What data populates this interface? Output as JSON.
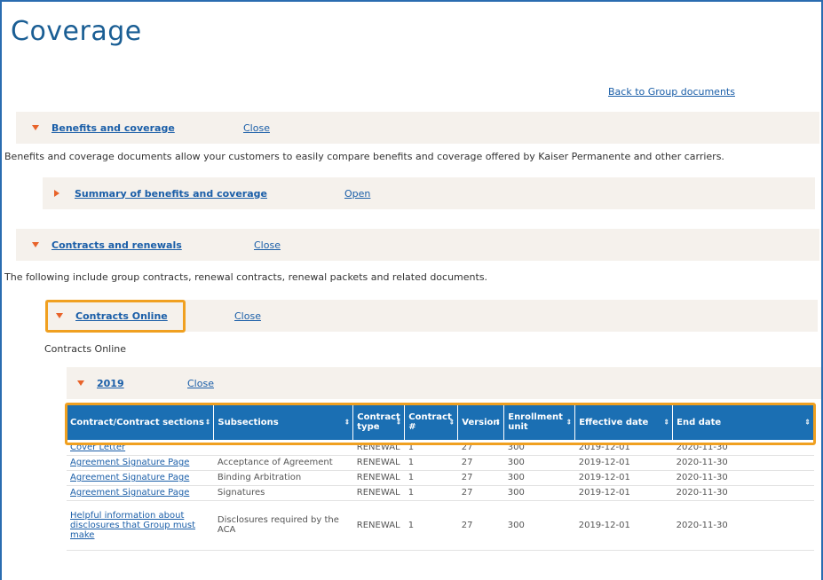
{
  "page": {
    "title": "Coverage",
    "back_link": "Back to Group documents"
  },
  "sections": {
    "benefits": {
      "title": "Benefits and coverage",
      "toggle": "Close",
      "description": "Benefits and coverage documents allow your customers to easily compare benefits and coverage offered by Kaiser Permanente and other carriers.",
      "summary": {
        "title": "Summary of benefits and coverage",
        "toggle": "Open"
      }
    },
    "contracts": {
      "title": "Contracts and renewals",
      "toggle": "Close",
      "description": "The following include group contracts, renewal contracts, renewal packets and related documents.",
      "online": {
        "title": "Contracts Online",
        "toggle": "Close",
        "label": "Contracts Online",
        "year": {
          "title": "2019",
          "toggle": "Close"
        }
      }
    }
  },
  "table": {
    "sort_icon": "sort-arrows-icon",
    "columns": [
      "Contract/Contract sections",
      "Subsections",
      "Contract type",
      "Contract #",
      "Version",
      "Enrollment unit",
      "Effective date",
      "End date"
    ],
    "rows": [
      [
        "Cover Letter",
        "",
        "RENEWAL",
        "1",
        "27",
        "300",
        "2019-12-01",
        "2020-11-30"
      ],
      [
        "Agreement Signature Page",
        "Acceptance of Agreement",
        "RENEWAL",
        "1",
        "27",
        "300",
        "2019-12-01",
        "2020-11-30"
      ],
      [
        "Agreement Signature Page",
        "Binding Arbitration",
        "RENEWAL",
        "1",
        "27",
        "300",
        "2019-12-01",
        "2020-11-30"
      ],
      [
        "Agreement Signature Page",
        "Signatures",
        "RENEWAL",
        "1",
        "27",
        "300",
        "2019-12-01",
        "2020-11-30"
      ],
      [
        "Helpful information about disclosures that Group must make",
        "Disclosures required by the ACA",
        "RENEWAL",
        "1",
        "27",
        "300",
        "2019-12-01",
        "2020-11-30"
      ]
    ]
  },
  "colors": {
    "accent": "#1b6fb3",
    "highlight": "#f0a020",
    "toggle_icon": "#e8632a",
    "bar_bg": "#f5f1ec"
  }
}
